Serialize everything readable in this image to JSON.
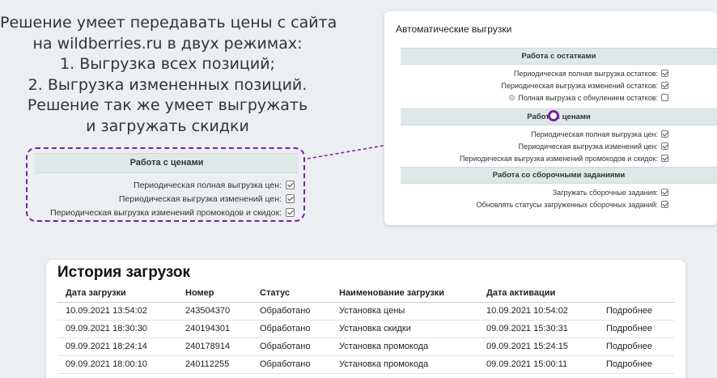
{
  "caption": {
    "lines": [
      "Решение умеет передавать цены с сайта",
      "на wildberries.ru в двух режимах:",
      "1. Выгрузка всех позиций;",
      "2. Выгрузка измененных позиций.",
      "Решение так же умеет выгружать",
      "и загружать скидки"
    ]
  },
  "panel": {
    "title": "Автоматические выгрузки",
    "stock": {
      "title": "Работа с остатками",
      "items": [
        {
          "label": "Периодическая полная выгрузка остатков:",
          "checked": true
        },
        {
          "label": "Периодическая выгрузка изменений остатков:",
          "checked": true
        },
        {
          "label": "Полная выгрузка с обнулением остатков:",
          "checked": false
        }
      ]
    },
    "prices": {
      "title": "Работа с ценами",
      "items": [
        {
          "label": "Периодическая полная выгрузка цен:",
          "checked": true
        },
        {
          "label": "Периодическая выгрузка изменений цен:",
          "checked": true
        },
        {
          "label": "Периодическая выгрузка изменений промокодов и скидок:",
          "checked": true
        }
      ]
    },
    "assembly": {
      "title": "Работа со сборочными заданиями",
      "items": [
        {
          "label": "Загружать сборочные задания:",
          "checked": true
        },
        {
          "label": "Обновлять статусы загруженных сборочных заданий:",
          "checked": true
        }
      ]
    }
  },
  "zoom": {
    "title": "Работа с ценами",
    "items": [
      {
        "label": "Периодическая полная выгрузка цен:",
        "checked": true
      },
      {
        "label": "Периодическая выгрузка изменений цен:",
        "checked": true
      },
      {
        "label": "Периодическая выгрузка изменений промокодов и скидок:",
        "checked": true
      }
    ]
  },
  "history": {
    "title": "История загрузок",
    "columns": [
      "Дата загрузки",
      "Номер",
      "Статус",
      "Наименование загрузки",
      "Дата активации",
      ""
    ],
    "rows": [
      [
        "10.09.2021 13:54:02",
        "243504370",
        "Обработано",
        "Установка цены",
        "10.09.2021 10:54:02",
        "Подробнее"
      ],
      [
        "09.09.2021 18:30:30",
        "240194301",
        "Обработано",
        "Установка скидки",
        "09.09.2021 15:30:31",
        "Подробнее"
      ],
      [
        "09.09.2021 18:24:14",
        "240178914",
        "Обработано",
        "Установка промокода",
        "09.09.2021 15:24:15",
        "Подробнее"
      ],
      [
        "09.09.2021 18:00:10",
        "240112255",
        "Обработано",
        "Установка промокода",
        "09.09.2021 15:00:11",
        "Подробнее"
      ]
    ]
  },
  "colors": {
    "accent": "#7a1fa2",
    "section_bg": "#dfe8e8",
    "page_bg": "#eceff2"
  }
}
